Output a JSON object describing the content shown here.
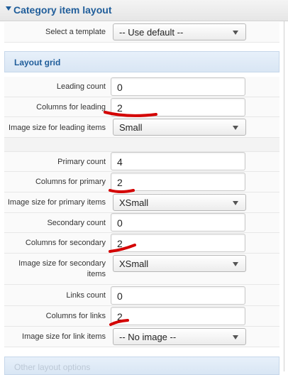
{
  "category_layout": {
    "title": "Category item layout",
    "template_label": "Select a template",
    "template_value": "-- Use default --"
  },
  "layout_grid": {
    "title": "Layout grid",
    "leading_count_label": "Leading count",
    "leading_count_value": "0",
    "columns_leading_label": "Columns for leading",
    "columns_leading_value": "2",
    "image_leading_label": "Image size for leading items",
    "image_leading_value": "Small",
    "primary_count_label": "Primary count",
    "primary_count_value": "4",
    "columns_primary_label": "Columns for primary",
    "columns_primary_value": "2",
    "image_primary_label": "Image size for primary items",
    "image_primary_value": "XSmall",
    "secondary_count_label": "Secondary count",
    "secondary_count_value": "0",
    "columns_secondary_label": "Columns for secondary",
    "columns_secondary_value": "2",
    "image_secondary_label": "Image size for secondary items",
    "image_secondary_value": "XSmall",
    "links_count_label": "Links count",
    "links_count_value": "0",
    "columns_links_label": "Columns for links",
    "columns_links_value": "2",
    "image_links_label": "Image size for link items",
    "image_links_value": "-- No image --"
  },
  "other_layout": {
    "title": "Other layout options"
  },
  "colors": {
    "accent": "#1f5d9a",
    "annotation": "#d40000"
  }
}
